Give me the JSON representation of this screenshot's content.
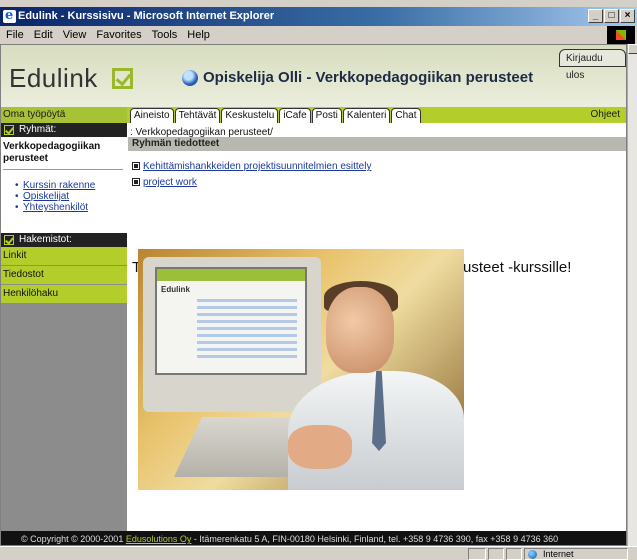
{
  "window": {
    "title": "Edulink - Kurssisivu - Microsoft Internet Explorer",
    "buttons": [
      "_",
      "□",
      "×"
    ]
  },
  "menu": [
    "File",
    "Edit",
    "View",
    "Favorites",
    "Tools",
    "Help"
  ],
  "header": {
    "logo": "Edulink",
    "title": "Opiskelija Olli - Verkkopedagogiikan perusteet",
    "logout": "Kirjaudu ulos"
  },
  "tabrow": {
    "workspace": "Oma työpöytä",
    "tabs": [
      "Aineisto",
      "Tehtävät",
      "Keskustelu",
      "iCafe",
      "Posti",
      "Kalenteri",
      "Chat"
    ],
    "help": "Ohjeet"
  },
  "sidebar": {
    "groups_label": "Ryhmät:",
    "course_title": "Verkkopedagogiikan perusteet",
    "links": [
      "Kurssin rakenne",
      "Opiskelijat",
      "Yhteyshenkilöt"
    ],
    "dirs_label": "Hakemistot:",
    "items": [
      "Linkit",
      "Tiedostot",
      "Henkilöhaku"
    ]
  },
  "main": {
    "breadcrumb": ": Verkkopedagogiikan perusteet/",
    "group_bar": "Ryhmän tiedotteet",
    "notices": [
      "Kehittämishankkeiden projektisuunnitelmien esittely",
      "project work"
    ],
    "welcome": "Tervetuloa opiskelemaan Verkkopedagogiikan perusteet -kurssille!",
    "photo_screen_title": "Edulink"
  },
  "footer": {
    "prefix": "© Copyright © 2000-2001 ",
    "company": "Edusolutions Oy",
    "suffix": " - Itämerenkatu 5 A, FIN-00180 Helsinki, Finland, tel. +358 9 4736 390, fax +358 9 4736 360"
  },
  "status": {
    "zone": "Internet"
  },
  "colors": {
    "accent": "#b3cd2b",
    "sidebar_bg": "#8c8c8c",
    "link": "#1a3a9c"
  }
}
